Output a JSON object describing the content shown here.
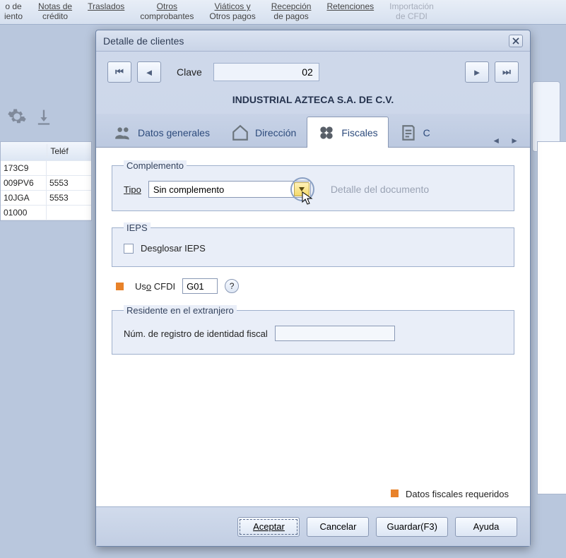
{
  "ribbon": {
    "items": [
      {
        "l1": "o de",
        "l2": "iento"
      },
      {
        "l1": "Notas de",
        "l2": "crédito"
      },
      {
        "l1": "Traslados",
        "l2": ""
      },
      {
        "l1": "Otros",
        "l2": "comprobantes"
      },
      {
        "l1": "Viáticos y",
        "l2": "Otros pagos"
      },
      {
        "l1": "Recepción",
        "l2": "de pagos"
      },
      {
        "l1": "Retenciones",
        "l2": ""
      },
      {
        "l1": "Importación",
        "l2": "de CFDI",
        "disabled": true
      }
    ]
  },
  "bg_table": {
    "hdr1": "",
    "hdr2": "Teléf",
    "rows": [
      {
        "c1": "173C9",
        "c2": ""
      },
      {
        "c1": "009PV6",
        "c2": "5553"
      },
      {
        "c1": "10JGA",
        "c2": "5553"
      },
      {
        "c1": "01000",
        "c2": ""
      }
    ]
  },
  "dialog": {
    "title": "Detalle de clientes",
    "clave_label": "Clave",
    "clave_value": "02",
    "company": "INDUSTRIAL AZTECA S.A. DE C.V.",
    "tabs": {
      "general": "Datos generales",
      "direccion": "Dirección",
      "fiscales": "Fiscales",
      "cobros_partial": "C"
    },
    "complemento": {
      "legend": "Complemento",
      "tipo_label": "Tipo",
      "tipo_value": "Sin complemento",
      "detalle": "Detalle del documento"
    },
    "ieps": {
      "legend": "IEPS",
      "desglosar": "Desglosar IEPS"
    },
    "uso": {
      "label": "Uso CFDI",
      "value": "G01"
    },
    "residente": {
      "legend": "Residente en el extranjero",
      "num_label": "Núm. de registro de identidad fiscal",
      "value": ""
    },
    "required_note": "Datos fiscales requeridos",
    "buttons": {
      "aceptar": "Aceptar",
      "cancelar": "Cancelar",
      "guardar": "Guardar(F3)",
      "ayuda": "Ayuda"
    }
  }
}
